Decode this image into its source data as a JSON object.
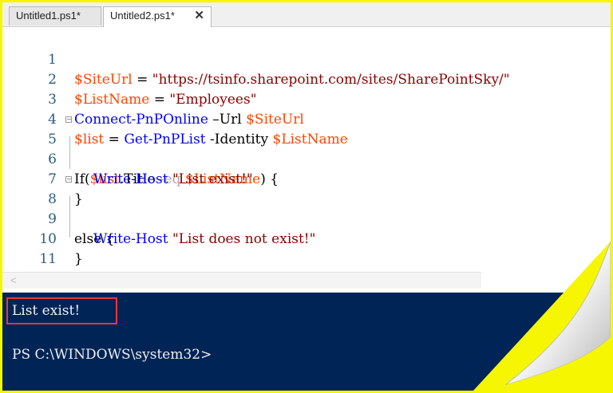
{
  "tabs": [
    {
      "label": "Untitled1.ps1*"
    },
    {
      "label": "Untitled2.ps1*",
      "close": "✕"
    }
  ],
  "editor": {
    "line_numbers": [
      "1",
      "2",
      "3",
      "4",
      "5",
      "6",
      "7",
      "8",
      "9",
      "10",
      "11"
    ],
    "lines": {
      "l1": {
        "var": "$SiteUrl",
        "eq": " = ",
        "str": "\"https://tsinfo.sharepoint.com/sites/SharePointSky/\""
      },
      "l2": {
        "var": "$ListName",
        "eq": " = ",
        "str": "\"Employees\""
      },
      "l3": {
        "cmd": "Connect-PnPOnline",
        "param": " –Url ",
        "var": "$SiteUrl"
      },
      "l4": {
        "var": "$list",
        "eq": " = ",
        "cmd": "Get-PnPList",
        "param": " -Identity ",
        "var2": "$ListName"
      },
      "l5": {
        "kw": "If(",
        "var": "$list",
        "prop": ".Title ",
        "op": "-eq",
        "sp": " ",
        "var2": "$ListName",
        "end": ") {"
      },
      "l6": {
        "cmd": "Write-Host",
        "sp": " ",
        "str": "\"List exist!\""
      },
      "l7": {
        "brace": "}"
      },
      "l8": {
        "kw": "else {"
      },
      "l9": {
        "cmd": "Write-Host",
        "sp": " ",
        "str": "\"List does not exist!\""
      },
      "l10": {
        "brace": "}"
      }
    }
  },
  "scroll": {
    "left_arrow": "<"
  },
  "console": {
    "output": "List exist!",
    "prompt": "PS C:\\WINDOWS\\system32>"
  }
}
